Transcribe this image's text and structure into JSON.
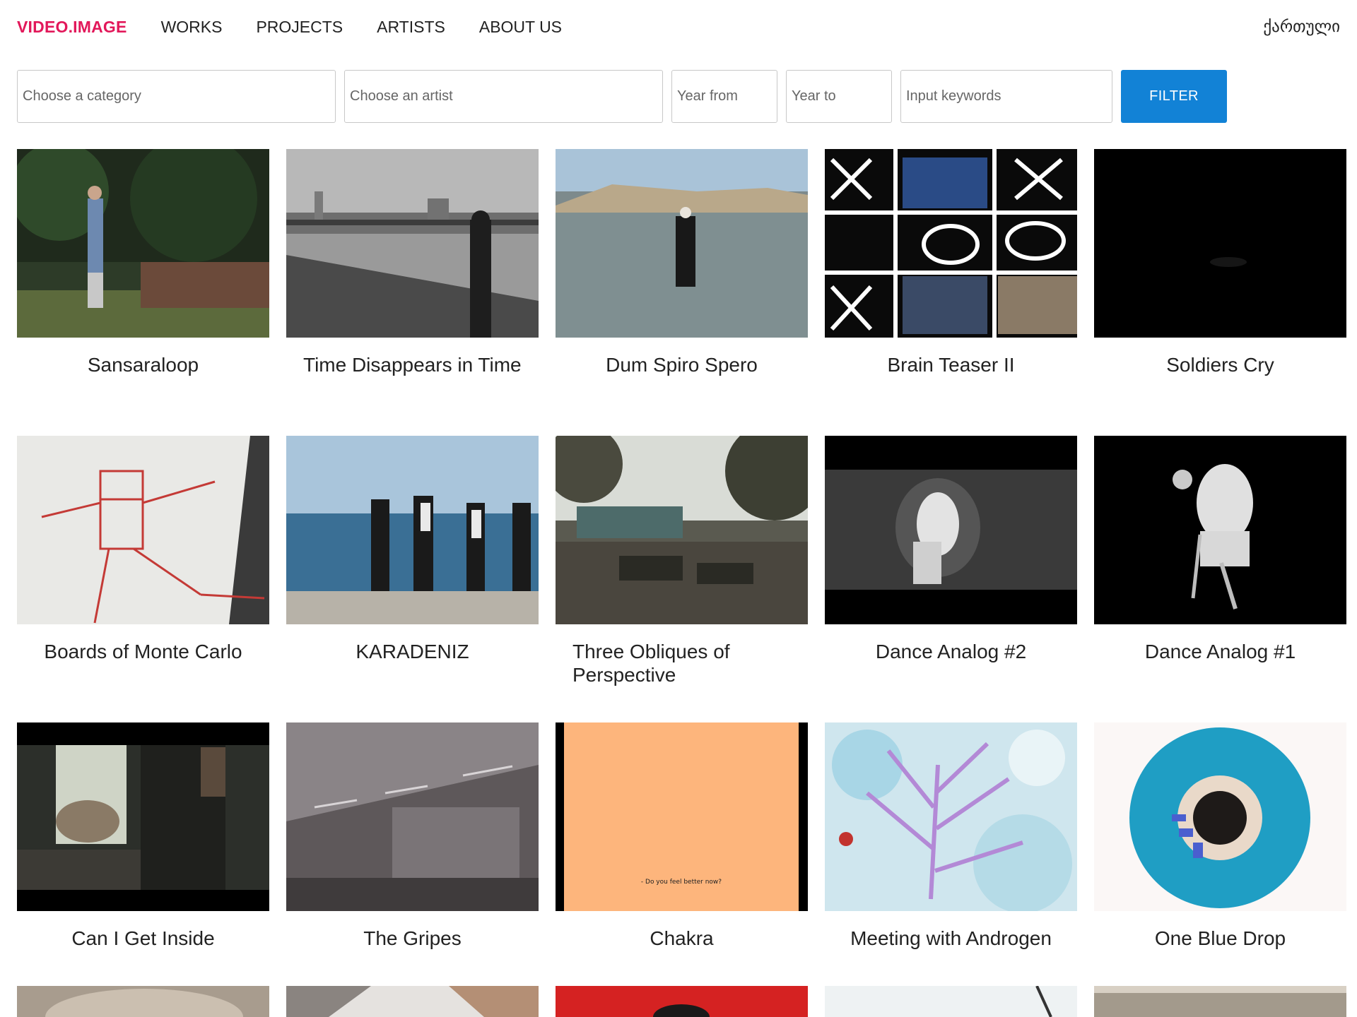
{
  "header": {
    "logo": "VIDEO.IMAGE",
    "nav": [
      "WORKS",
      "PROJECTS",
      "ARTISTS",
      "ABOUT US"
    ],
    "language": "ქართული"
  },
  "filters": {
    "category_placeholder": "Choose a category",
    "artist_placeholder": "Choose an artist",
    "year_from_placeholder": "Year from",
    "year_to_placeholder": "Year to",
    "keywords_placeholder": "Input keywords",
    "button_label": "FILTER"
  },
  "works": [
    {
      "title": "Sansaraloop"
    },
    {
      "title": "Time Disappears in Time"
    },
    {
      "title": "Dum Spiro Spero"
    },
    {
      "title": "Brain Teaser II"
    },
    {
      "title": "Soldiers Cry"
    },
    {
      "title": "Boards of Monte Carlo"
    },
    {
      "title": "KARADENIZ"
    },
    {
      "title": "Three Obliques of Perspective"
    },
    {
      "title": "Dance Analog #2"
    },
    {
      "title": "Dance Analog #1"
    },
    {
      "title": "Can I Get Inside"
    },
    {
      "title": "The Gripes"
    },
    {
      "title": "Chakra",
      "subtitle": "- Do you feel better now?"
    },
    {
      "title": "Meeting with Androgen"
    },
    {
      "title": "One Blue Drop"
    }
  ],
  "colors": {
    "logo": "#e2185a",
    "filter_button": "#1282d6"
  }
}
